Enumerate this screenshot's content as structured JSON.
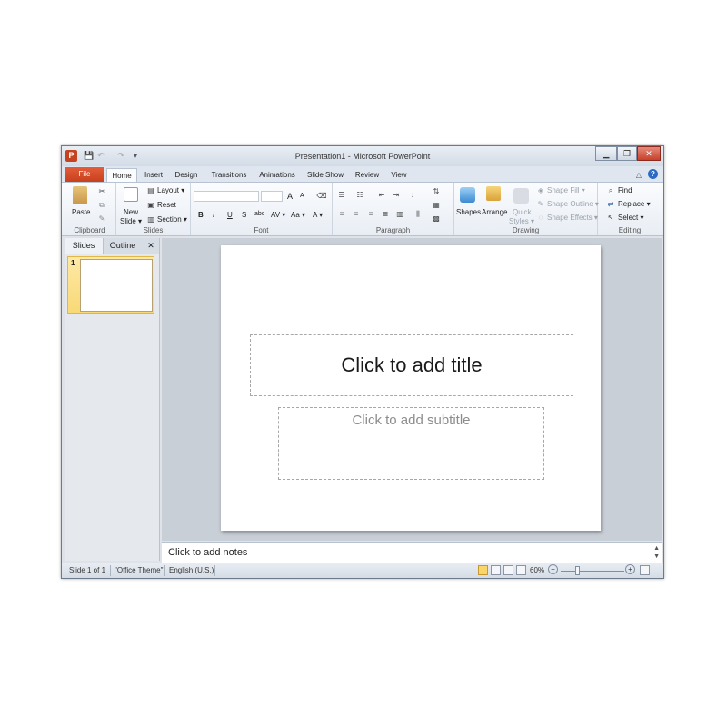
{
  "window": {
    "title": "Presentation1 - Microsoft PowerPoint",
    "app_icon_letter": "P",
    "minimize_glyph": "▁",
    "restore_glyph": "❐",
    "close_glyph": "✕"
  },
  "quick_access": {
    "save_glyph": "💾",
    "undo_glyph": "↶",
    "redo_glyph": "↷",
    "customize_glyph": "▾"
  },
  "ribbon_tabs": [
    {
      "label": "File"
    },
    {
      "label": "Home"
    },
    {
      "label": "Insert"
    },
    {
      "label": "Design"
    },
    {
      "label": "Transitions"
    },
    {
      "label": "Animations"
    },
    {
      "label": "Slide Show"
    },
    {
      "label": "Review"
    },
    {
      "label": "View"
    }
  ],
  "help": {
    "minimize_ribbon_glyph": "△",
    "help_glyph": "?"
  },
  "ribbon": {
    "clipboard": {
      "label": "Clipboard",
      "paste": "Paste"
    },
    "slides": {
      "label": "Slides",
      "new_slide_1": "New",
      "new_slide_2": "Slide ▾",
      "layout": "Layout ▾",
      "reset": "Reset",
      "section": "Section ▾"
    },
    "font": {
      "label": "Font",
      "bold": "B",
      "italic": "I",
      "underline": "U",
      "strike": "S",
      "abc": "abc",
      "spacing": "AV ▾",
      "case": "Aa ▾",
      "color": "A ▾",
      "grow": "A",
      "shrink": "A"
    },
    "paragraph": {
      "label": "Paragraph"
    },
    "drawing": {
      "label": "Drawing",
      "shapes": "Shapes",
      "arrange": "Arrange",
      "quick_styles_1": "Quick",
      "quick_styles_2": "Styles ▾",
      "shape_fill": "Shape Fill ▾",
      "shape_outline": "Shape Outline ▾",
      "shape_effects": "Shape Effects ▾"
    },
    "editing": {
      "label": "Editing",
      "find": "Find",
      "replace": "Replace ▾",
      "select": "Select ▾"
    }
  },
  "panel": {
    "tab_slides": "Slides",
    "tab_outline": "Outline",
    "close_glyph": "✕",
    "slide_number": "1"
  },
  "slide": {
    "title_placeholder": "Click to add title",
    "subtitle_placeholder": "Click to add subtitle"
  },
  "notes": {
    "placeholder": "Click to add notes"
  },
  "status": {
    "slide_info": "Slide 1 of 1",
    "theme": "\"Office Theme\"",
    "language": "English (U.S.)",
    "zoom": "60%",
    "zoom_out": "−",
    "zoom_in": "+"
  },
  "colors": {
    "file_tab": "#c8401c",
    "accent_selected": "#f9d976",
    "chrome": "#dfe3e9"
  }
}
